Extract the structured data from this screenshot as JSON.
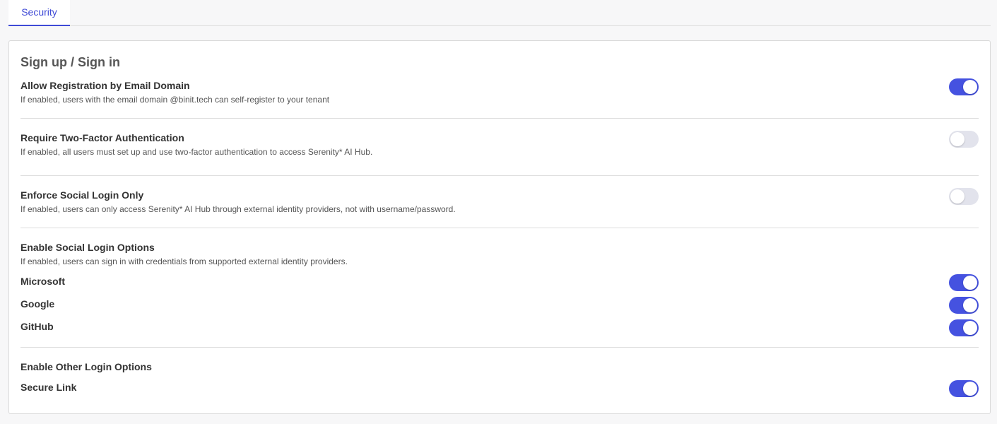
{
  "tabs": [
    {
      "label": "Security",
      "active": true
    }
  ],
  "section": {
    "title": "Sign up / Sign in"
  },
  "settings": {
    "email_registration": {
      "label": "Allow Registration by Email Domain",
      "description": "If enabled, users with the email domain @binit.tech can self-register to your tenant",
      "enabled": true
    },
    "two_factor": {
      "label": "Require Two-Factor Authentication",
      "description": "If enabled, all users must set up and use two-factor authentication to access Serenity* AI Hub.",
      "enabled": false
    },
    "social_only": {
      "label": "Enforce Social Login Only",
      "description": "If enabled, users can only access Serenity* AI Hub through external identity providers, not with username/password.",
      "enabled": false
    },
    "social_options": {
      "label": "Enable Social Login Options",
      "description": "If enabled, users can sign in with credentials from supported external identity providers.",
      "providers": [
        {
          "label": "Microsoft",
          "enabled": true
        },
        {
          "label": "Google",
          "enabled": true
        },
        {
          "label": "GitHub",
          "enabled": true
        }
      ]
    },
    "other_options": {
      "label": "Enable Other Login Options",
      "providers": [
        {
          "label": "Secure Link",
          "enabled": true
        }
      ]
    }
  },
  "colors": {
    "accent": "#4552e0",
    "toggle_off": "#e2e3ec"
  }
}
